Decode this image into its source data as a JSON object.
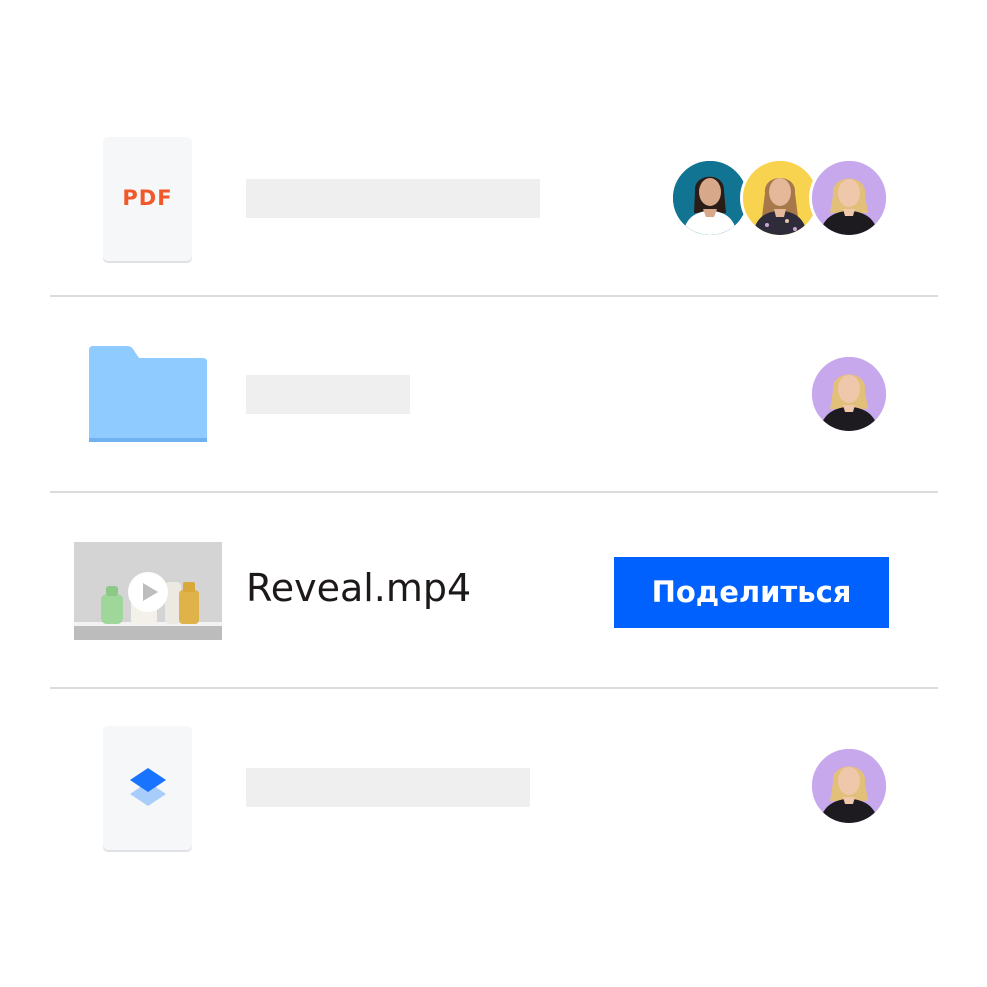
{
  "files": [
    {
      "type": "pdf",
      "icon": "pdf-document-icon",
      "icon_label": "PDF",
      "shared_with": [
        "avatar-teal",
        "avatar-yellow",
        "avatar-purple"
      ]
    },
    {
      "type": "folder",
      "icon": "folder-icon",
      "shared_with": [
        "avatar-purple"
      ]
    },
    {
      "type": "video",
      "icon": "video-thumbnail",
      "name": "Reveal.mp4",
      "action_label": "Поделиться"
    },
    {
      "type": "dropbox-file",
      "icon": "dropbox-logo-icon",
      "shared_with": [
        "avatar-purple"
      ]
    }
  ],
  "colors": {
    "pdf_label": "#f1592a",
    "folder": "#8fcbff",
    "share_button": "#0061fe",
    "avatar_teal": "#127493",
    "avatar_yellow": "#f7d34f",
    "avatar_purple": "#c7a8ec",
    "placeholder": "#efefef"
  }
}
